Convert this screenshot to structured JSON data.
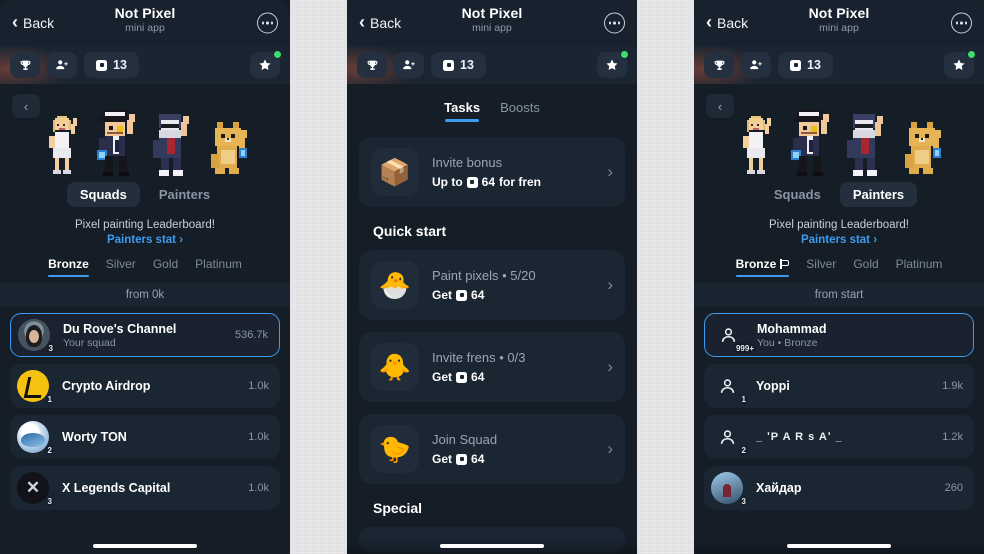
{
  "app": {
    "header": {
      "back_label": "Back",
      "title": "Not Pixel",
      "subtitle": "mini app",
      "menu_icon": "more-dots-icon"
    },
    "toolbar": {
      "trophy_icon": "trophy-icon",
      "add_friend_icon": "add-person-icon",
      "counter_value": "13",
      "counter_icon": "pixel-square-icon",
      "star_icon": "star-icon",
      "star_badge_color": "#3ddc6b"
    },
    "accent_color": "#3d9bf0",
    "bg_color": "#151d27",
    "card_color": "#1b2633"
  },
  "panel1": {
    "back_chevron_icon": "chevron-left-icon",
    "characters": [
      "pixel-woman",
      "pixel-gentleman",
      "pixel-hoodie-man",
      "pixel-dog"
    ],
    "segments": [
      {
        "label": "Squads",
        "active": true
      },
      {
        "label": "Painters",
        "active": false
      }
    ],
    "leaderboard_text": "Pixel painting Leaderboard!",
    "stat_link": "Painters stat ›",
    "tiers": [
      {
        "label": "Bronze",
        "active": true,
        "flag": false
      },
      {
        "label": "Silver",
        "active": false,
        "flag": false
      },
      {
        "label": "Gold",
        "active": false,
        "flag": false
      },
      {
        "label": "Platinum",
        "active": false,
        "flag": false
      }
    ],
    "from_label": "from 0k",
    "rows": [
      {
        "rank": "3",
        "name": "Du Rove's Channel",
        "sub": "Your squad",
        "value": "536.7k",
        "highlight": true,
        "avatar": "ava-durov"
      },
      {
        "rank": "1",
        "name": "Crypto Airdrop",
        "sub": "",
        "value": "1.0k",
        "highlight": false,
        "avatar": "ava-crypto"
      },
      {
        "rank": "2",
        "name": "Worty TON",
        "sub": "",
        "value": "1.0k",
        "highlight": false,
        "avatar": "ava-worty"
      },
      {
        "rank": "3",
        "name": "X Legends Capital",
        "sub": "",
        "value": "1.0k",
        "highlight": false,
        "avatar": "ava-xleg"
      }
    ]
  },
  "panel2": {
    "tabs": [
      {
        "label": "Tasks",
        "active": true
      },
      {
        "label": "Boosts",
        "active": false
      }
    ],
    "invite_task": {
      "icon": "📦",
      "title": "Invite bonus",
      "reward_prefix": "Up to",
      "reward_value": "64",
      "reward_suffix": "for fren",
      "arrow_icon": "chevron-right-icon"
    },
    "quick_start_heading": "Quick start",
    "quick_tasks": [
      {
        "icon": "🐣",
        "title": "Paint pixels • 5/20",
        "reward_prefix": "Get",
        "reward_value": "64",
        "reward_suffix": "",
        "arrow_icon": "chevron-right-icon"
      },
      {
        "icon": "🐥",
        "title": "Invite frens • 0/3",
        "reward_prefix": "Get",
        "reward_value": "64",
        "reward_suffix": "",
        "arrow_icon": "chevron-right-icon"
      },
      {
        "icon": "🐤",
        "title": "Join Squad",
        "reward_prefix": "Get",
        "reward_value": "64",
        "reward_suffix": "",
        "arrow_icon": "chevron-right-icon"
      }
    ],
    "special_heading": "Special"
  },
  "panel3": {
    "back_chevron_icon": "chevron-left-icon",
    "characters": [
      "pixel-woman",
      "pixel-gentleman",
      "pixel-hoodie-man",
      "pixel-dog"
    ],
    "segments": [
      {
        "label": "Squads",
        "active": false
      },
      {
        "label": "Painters",
        "active": true
      }
    ],
    "leaderboard_text": "Pixel painting Leaderboard!",
    "stat_link": "Painters stat ›",
    "tiers": [
      {
        "label": "Bronze",
        "active": true,
        "flag": true
      },
      {
        "label": "Silver",
        "active": false,
        "flag": false
      },
      {
        "label": "Gold",
        "active": false,
        "flag": false
      },
      {
        "label": "Platinum",
        "active": false,
        "flag": false
      }
    ],
    "from_label": "from start",
    "rows": [
      {
        "rank": "999+",
        "name": "Mohammad",
        "sub": "You • Bronze",
        "value": "",
        "highlight": true,
        "avatar": "person-ico"
      },
      {
        "rank": "1",
        "name": "Yoppi",
        "sub": "",
        "value": "1.9k",
        "highlight": false,
        "avatar": "person-ico"
      },
      {
        "rank": "2",
        "name": "_ ʹP A R s Aʹ _",
        "sub": "",
        "value": "1.2k",
        "highlight": false,
        "avatar": "person-ico"
      },
      {
        "rank": "3",
        "name": "Хайдар",
        "sub": "",
        "value": "260",
        "highlight": false,
        "avatar": "ava-khai"
      }
    ]
  }
}
